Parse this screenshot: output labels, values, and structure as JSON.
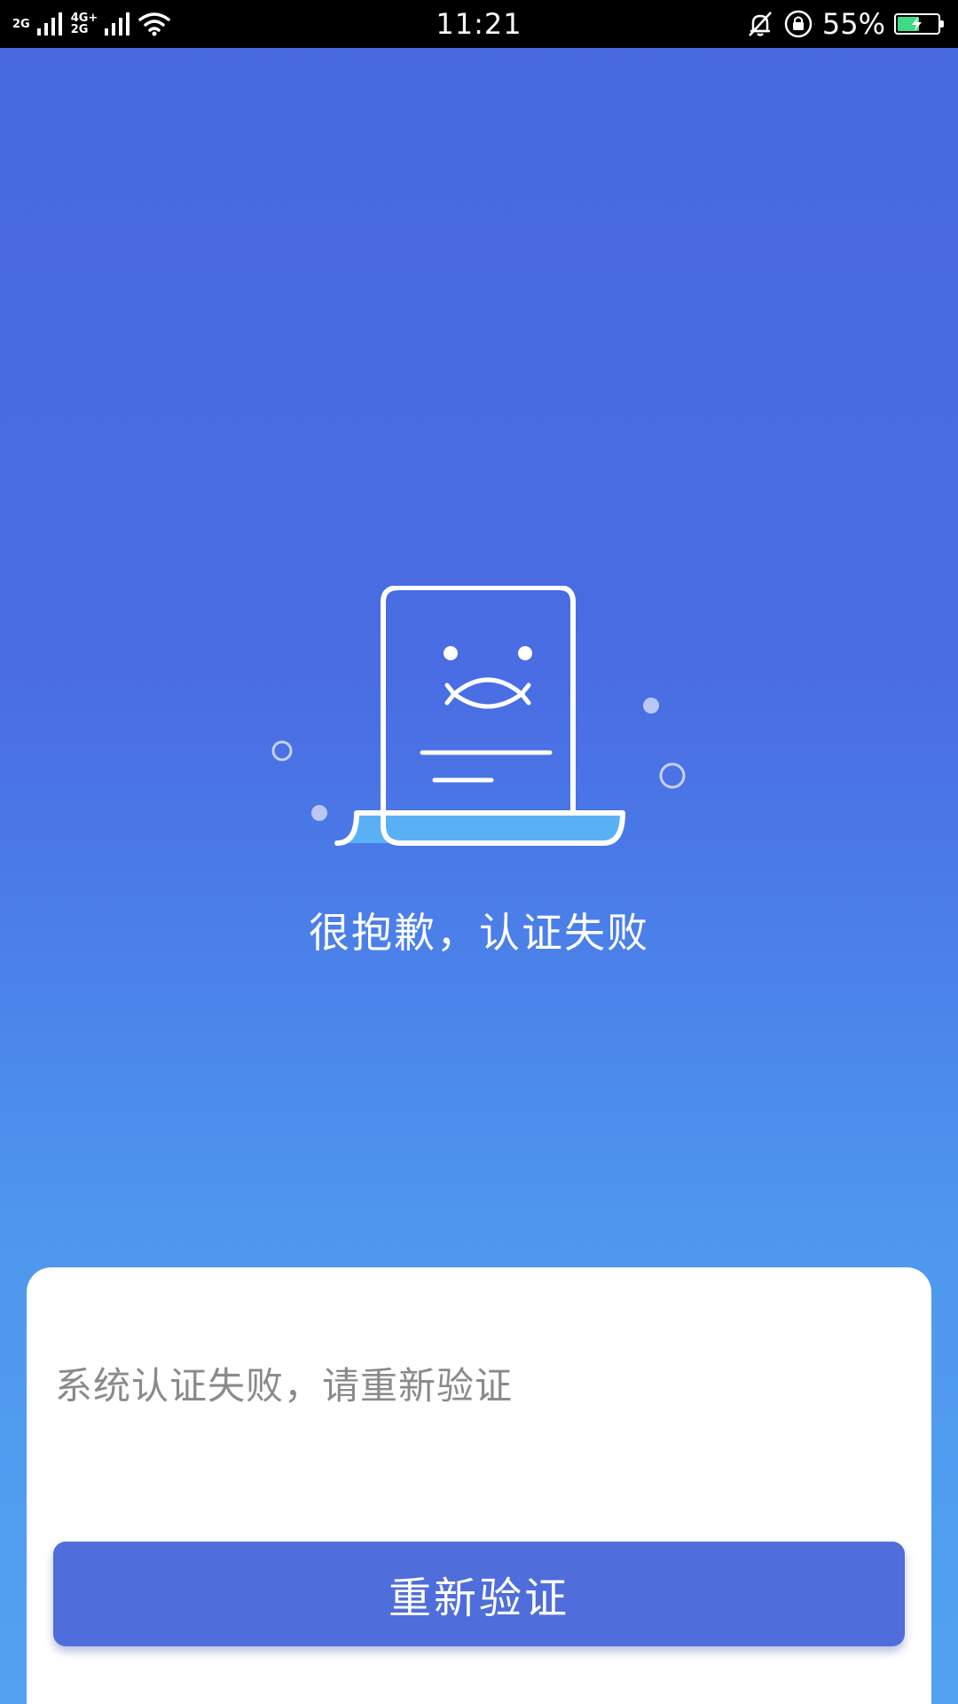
{
  "status_bar": {
    "network_1": "2G",
    "network_2_top": "4G+",
    "network_2_bottom": "2G",
    "time": "11:21",
    "battery_percent": "55%",
    "battery_level": 0.55,
    "icons": [
      "signal-icon",
      "wifi-icon",
      "bell-muted-icon",
      "rotation-lock-icon",
      "battery-charging-icon"
    ]
  },
  "main": {
    "illustration_icon": "sad-document-icon",
    "title": "很抱歉，认证失败"
  },
  "card": {
    "message": "系统认证失败，请重新验证",
    "retry_label": "重新验证"
  },
  "colors": {
    "background_top": "#4869e0",
    "background_bottom": "#52a2f1",
    "button": "#4f6ddb",
    "accent_paper": "#5ab0f5",
    "message_text": "#8a8a8a"
  }
}
